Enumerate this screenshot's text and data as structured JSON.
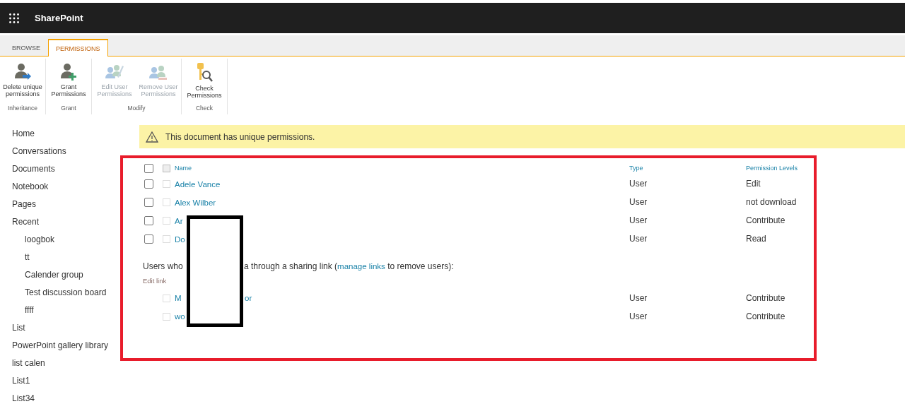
{
  "app": {
    "title": "SharePoint"
  },
  "ribbon": {
    "tabs": [
      {
        "label": "BROWSE",
        "selected": false
      },
      {
        "label": "PERMISSIONS",
        "selected": true
      }
    ],
    "groups": [
      {
        "label": "Inheritance",
        "buttons": [
          {
            "kind": "delete",
            "label": "Delete unique permissions",
            "disabled": false
          }
        ]
      },
      {
        "label": "Grant",
        "buttons": [
          {
            "kind": "grant",
            "label": "Grant Permissions",
            "disabled": false
          }
        ]
      },
      {
        "label": "Modify",
        "buttons": [
          {
            "kind": "edit",
            "label": "Edit User Permissions",
            "disabled": true
          },
          {
            "kind": "remove",
            "label": "Remove User Permissions",
            "disabled": true
          }
        ]
      },
      {
        "label": "Check",
        "buttons": [
          {
            "kind": "check",
            "label": "Check Permissions",
            "disabled": false
          }
        ]
      }
    ]
  },
  "nav": [
    {
      "label": "Home"
    },
    {
      "label": "Conversations"
    },
    {
      "label": "Documents"
    },
    {
      "label": "Notebook"
    },
    {
      "label": "Pages"
    },
    {
      "label": "Recent",
      "children": [
        {
          "label": "loogbok"
        },
        {
          "label": "tt"
        },
        {
          "label": "Calender group"
        },
        {
          "label": "Test discussion board"
        },
        {
          "label": "ffff"
        }
      ]
    },
    {
      "label": "List"
    },
    {
      "label": "PowerPoint gallery library"
    },
    {
      "label": "list calen"
    },
    {
      "label": "List1"
    },
    {
      "label": "List34"
    }
  ],
  "banner": {
    "text": "This document has unique permissions."
  },
  "table": {
    "columns": [
      "Name",
      "Type",
      "Permission Levels"
    ],
    "all_selected": false,
    "header_selected": false,
    "rows": [
      {
        "name": "Adele Vance",
        "type": "User",
        "permission": "Edit",
        "selected": false
      },
      {
        "name": "Alex Wilber",
        "type": "User",
        "permission": "not download",
        "selected": false
      },
      {
        "name": "Ar",
        "type": "User",
        "permission": "Contribute",
        "selected": false
      },
      {
        "name": "Do",
        "type": "User",
        "permission": "Read",
        "selected": false
      }
    ]
  },
  "sharing": {
    "note_start": "Users who",
    "note_before": "a through a sharing link (",
    "note_link": "manage links",
    "note_after": " to remove users):",
    "group_label": "Edit link",
    "rows": [
      {
        "name": "M",
        "name_tail": "or",
        "type": "User",
        "permission": "Contribute"
      },
      {
        "name": "wo",
        "type": "User",
        "permission": "Contribute"
      }
    ]
  }
}
